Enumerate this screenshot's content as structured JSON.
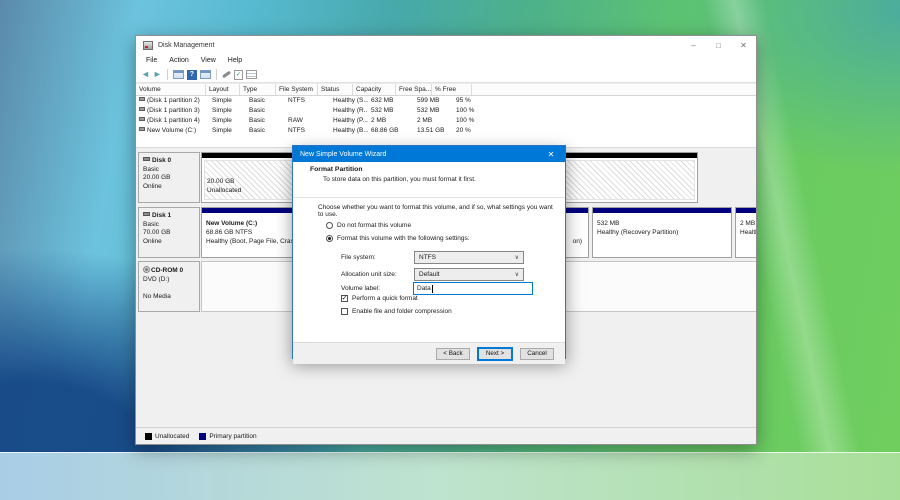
{
  "icons": {
    "back": "◄",
    "forward": "►",
    "help_glyph": "?",
    "doc_check": "✓",
    "minimize": "–",
    "maximize": "□",
    "close": "✕",
    "chevron": "∨",
    "check": "✓"
  },
  "window": {
    "title": "Disk Management",
    "menu": [
      "File",
      "Action",
      "View",
      "Help"
    ],
    "table": {
      "columns": [
        "Volume",
        "Layout",
        "Type",
        "File System",
        "Status",
        "Capacity",
        "Free Spa...",
        "% Free"
      ],
      "rows": [
        {
          "volume": "(Disk 1 partition 2)",
          "layout": "Simple",
          "type": "Basic",
          "fs": "NTFS",
          "status": "Healthy (S...",
          "capacity": "632 MB",
          "free": "599 MB",
          "pct": "95 %"
        },
        {
          "volume": "(Disk 1 partition 3)",
          "layout": "Simple",
          "type": "Basic",
          "fs": "",
          "status": "Healthy (R...",
          "capacity": "532 MB",
          "free": "532 MB",
          "pct": "100 %"
        },
        {
          "volume": "(Disk 1 partition 4)",
          "layout": "Simple",
          "type": "Basic",
          "fs": "RAW",
          "status": "Healthy (P...",
          "capacity": "2 MB",
          "free": "2 MB",
          "pct": "100 %"
        },
        {
          "volume": "New Volume (C:)",
          "layout": "Simple",
          "type": "Basic",
          "fs": "NTFS",
          "status": "Healthy (B...",
          "capacity": "68.86 GB",
          "free": "13.51 GB",
          "pct": "20 %"
        }
      ]
    },
    "disk0": {
      "name": "Disk 0",
      "kind": "Basic",
      "size": "20.00 GB",
      "state": "Online",
      "part_size": "20.00 GB",
      "part_label": "Unallocated"
    },
    "disk1": {
      "name": "Disk 1",
      "kind": "Basic",
      "size": "70.00 GB",
      "state": "Online",
      "seg1_title": "New Volume  (C:)",
      "seg1_line2": "68.86 GB NTFS",
      "seg1_line3": "Healthy (Boot, Page File, Crash Dump, Primary Partition)",
      "seg1_tail": "on)",
      "seg2_line1": "532 MB",
      "seg2_line2": "Healthy (Recovery Partition)",
      "seg3_line1": "2 MB",
      "seg3_line2": "Healthy"
    },
    "cdrom": {
      "name": "CD-ROM 0",
      "drive": "DVD (D:)",
      "media": "No Media"
    },
    "legend": {
      "unallocated": "Unallocated",
      "primary": "Primary partition"
    }
  },
  "dialog": {
    "title": "New Simple Volume Wizard",
    "heading": "Format Partition",
    "subheading": "To store data on this partition, you must format it first.",
    "body_text": "Choose whether you want to format this volume, and if so, what settings you want to use.",
    "radio_no_format": "Do not format this volume",
    "radio_format": "Format this volume with the following settings:",
    "file_system_label": "File system:",
    "file_system_value": "NTFS",
    "allocation_label": "Allocation unit size:",
    "allocation_value": "Default",
    "volume_label_label": "Volume label:",
    "volume_label_value": "Data",
    "quick_format_label": "Perform a quick format",
    "compression_label": "Enable file and folder compression",
    "back_button": "< Back",
    "next_button": "Next >",
    "cancel_button": "Cancel"
  },
  "colors": {
    "accent": "#0078d7",
    "primary_partition": "#00007e",
    "unallocated": "#000000"
  }
}
